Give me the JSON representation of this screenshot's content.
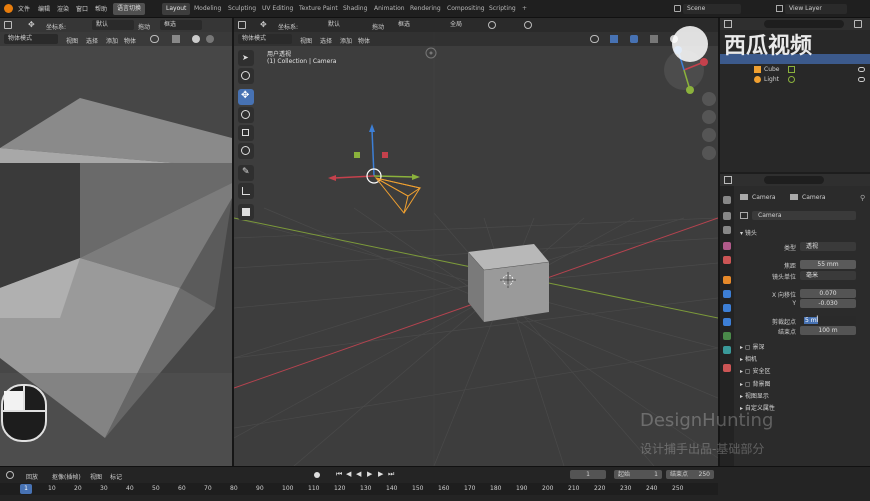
{
  "topbar": {
    "menus": [
      "文件",
      "编辑",
      "渲染",
      "窗口",
      "帮助"
    ],
    "workspace_label": "语言切换",
    "tabs": [
      "Layout",
      "Modeling",
      "Sculpting",
      "UV Editing",
      "Texture Paint",
      "Shading",
      "Animation",
      "Rendering",
      "Compositing",
      "Scripting"
    ],
    "add_tab": "+",
    "scene_label": "Scene",
    "view_layer_label": "View Layer"
  },
  "left_view": {
    "header": {
      "transform_label": "坐标系:",
      "transform_value": "默认",
      "drag_label": "拖动",
      "select_mode": "框选",
      "mode_label": "物体模式",
      "menus": [
        "视图",
        "选择",
        "添加",
        "物体"
      ]
    }
  },
  "main_view": {
    "header": {
      "transform_label": "坐标系:",
      "transform_value": "默认",
      "drag_label": "拖动",
      "select_mode": "框选",
      "pivot_value": "全局",
      "mode_label": "物体模式",
      "menus": [
        "视图",
        "选择",
        "添加",
        "物体"
      ]
    },
    "overlay_title": "用户透视",
    "overlay_subtitle": "(1) Collection | Camera"
  },
  "outliner": {
    "items": [
      {
        "label": "Cube",
        "icon": "cube-icon"
      },
      {
        "label": "Light",
        "icon": "light-icon"
      }
    ]
  },
  "properties": {
    "object_name": "Camera",
    "data_name": "Camera",
    "datablock": "Camera",
    "section_lens": "镜头",
    "type_label": "类型",
    "type_value": "透视",
    "focal_label": "焦距",
    "focal_value": "55 mm",
    "lens_unit_label": "镜头单位",
    "lens_unit_value": "毫米",
    "shift_x_label": "X 向移位",
    "shift_x_value": "0.070",
    "shift_y_label": "Y",
    "shift_y_value": "-0.030",
    "clip_start_label": "剪裁起点",
    "clip_start_value": "5 m",
    "clip_end_label": "结束点",
    "clip_end_value": "100 m",
    "sections": [
      "景深",
      "相机",
      "安全区",
      "背景图",
      "视图显示",
      "自定义属性"
    ]
  },
  "timeline": {
    "menus": [
      "回放",
      "抠像(插帧)",
      "视图",
      "标记"
    ],
    "current_frame": "1",
    "start_label": "起始",
    "start_value": "1",
    "end_label": "结束点",
    "end_value": "250",
    "ticks": [
      "1",
      "10",
      "20",
      "30",
      "40",
      "50",
      "60",
      "70",
      "80",
      "90",
      "100",
      "110",
      "120",
      "130",
      "140",
      "150",
      "160",
      "170",
      "180",
      "190",
      "200",
      "210",
      "220",
      "230",
      "240",
      "250"
    ]
  },
  "watermark": {
    "logo_text": "西瓜视频",
    "brand": "DesignHunting",
    "subtitle": "设计捕手出品-基础部分"
  },
  "colors": {
    "accent": "#4772b3",
    "x_axis": "#c5414c",
    "y_axis": "#8bb23c",
    "z_axis": "#3d7fd6",
    "camera": "#f0a030"
  }
}
